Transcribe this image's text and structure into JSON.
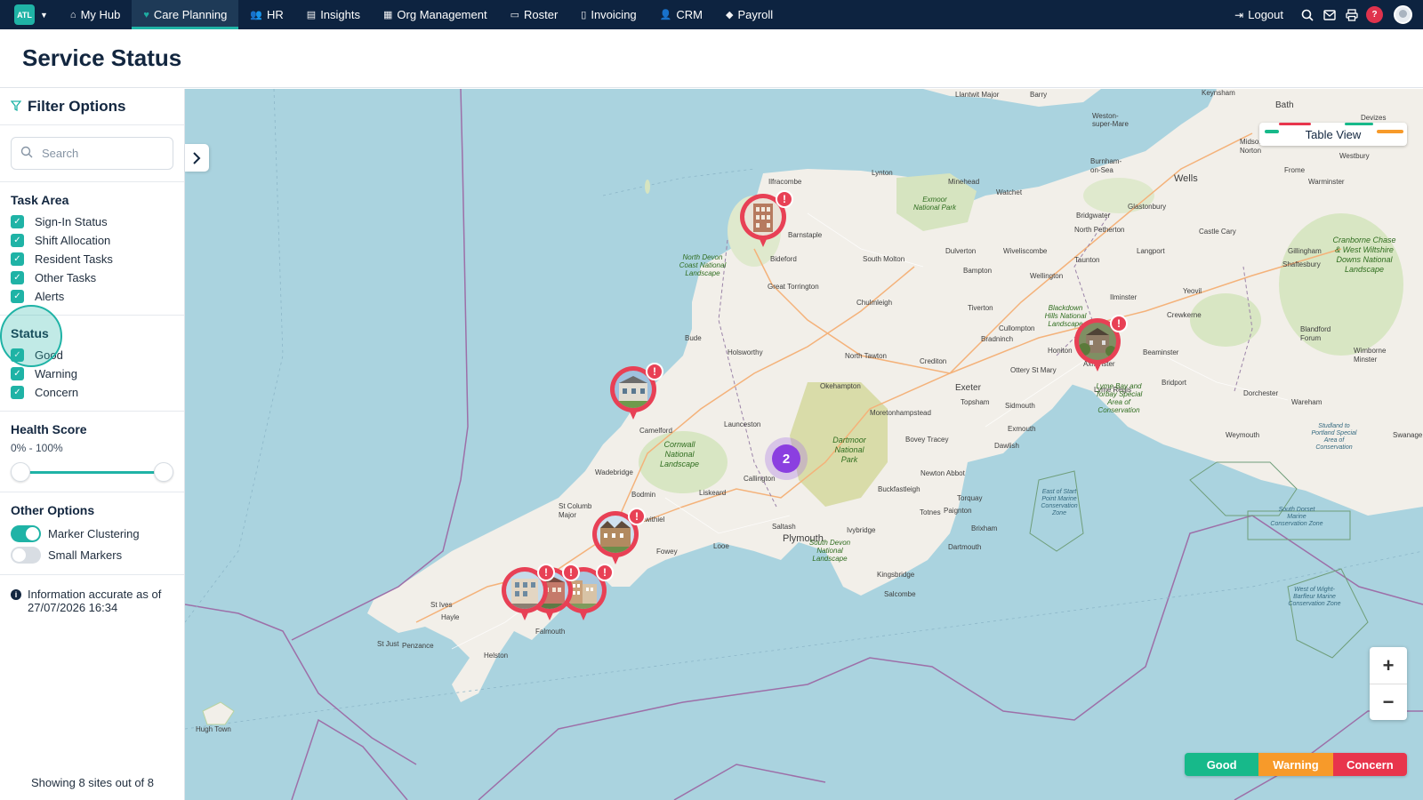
{
  "nav": {
    "brand": "ATL",
    "items": [
      {
        "label": "My Hub",
        "icon": "⌂"
      },
      {
        "label": "Care Planning",
        "icon": "♥"
      },
      {
        "label": "HR",
        "icon": "👥"
      },
      {
        "label": "Insights",
        "icon": "▤"
      },
      {
        "label": "Org Management",
        "icon": "▦"
      },
      {
        "label": "Roster",
        "icon": "▭"
      },
      {
        "label": "Invoicing",
        "icon": "▯"
      },
      {
        "label": "CRM",
        "icon": "👤"
      },
      {
        "label": "Payroll",
        "icon": "◆"
      }
    ],
    "logout": "Logout",
    "help": "?"
  },
  "page": {
    "title": "Service Status"
  },
  "sidebar": {
    "title": "Filter Options",
    "search_placeholder": "Search",
    "task_area": {
      "title": "Task Area",
      "items": [
        "Sign-In Status",
        "Shift Allocation",
        "Resident Tasks",
        "Other Tasks",
        "Alerts"
      ]
    },
    "status": {
      "title": "Status",
      "items": [
        "Good",
        "Warning",
        "Concern"
      ]
    },
    "health": {
      "title": "Health Score",
      "range": "0% - 100%",
      "min": 0,
      "max": 100
    },
    "other": {
      "title": "Other Options",
      "marker_clustering": "Marker Clustering",
      "marker_clustering_on": true,
      "small_markers": "Small Markers",
      "small_markers_on": false
    },
    "info": "Information accurate as of 27/07/2026 16:34",
    "showing": "Showing 8 sites out of 8"
  },
  "map": {
    "table_view": "Table View",
    "cluster_count": "2",
    "zoom_in": "+",
    "zoom_out": "−",
    "alert_glyph": "!",
    "legend": {
      "good": "Good",
      "warning": "Warning",
      "concern": "Concern"
    },
    "colors": {
      "good": "#17b98a",
      "warning": "#f79a2a",
      "concern": "#e8354c",
      "accent": "#1fb3a6"
    },
    "places": [
      "Llantwit Major",
      "Barry",
      "Keynsham",
      "Weston-super-Mare",
      "Bath",
      "Devizes",
      "Midsomer Norton",
      "Frome",
      "Westbury",
      "Burnham-on-Sea",
      "Wells",
      "Warminster",
      "Ilfracombe",
      "Lynton",
      "Minehead",
      "Watchet",
      "Bridgwater",
      "Glastonbury",
      "Castle Cary",
      "Barnstaple",
      "North Petherton",
      "Langport",
      "Gillingham",
      "Shaftesbury",
      "Bideford",
      "South Molton",
      "Dulverton",
      "Wiveliscombe",
      "Taunton",
      "Bampton",
      "Wellington",
      "Yeovil",
      "Great Torrington",
      "Chulmleigh",
      "Ilminster",
      "Crewkerne",
      "Tiverton",
      "Cullompton",
      "Bradninch",
      "Honiton",
      "Ottery St Mary",
      "Axminster",
      "Blandford Forum",
      "Wimborne Minster",
      "Bude",
      "Holsworthy",
      "North Tawton",
      "Crediton",
      "Beaminster",
      "Bridport",
      "Lyme Regis",
      "Dorchester",
      "Okehampton",
      "Exeter",
      "Sidmouth",
      "Topsham",
      "Wareham",
      "Camelford",
      "Launceston",
      "Moretonhampstead",
      "Bovey Tracey",
      "Dawlish",
      "Exmouth",
      "Weymouth",
      "Swanage",
      "Wadebridge",
      "Callington",
      "Newton Abbot",
      "Bodmin",
      "Liskeard",
      "Buckfastleigh",
      "Torquay",
      "St Columb Major",
      "Lostwithiel",
      "Saltash",
      "Totnes",
      "Paignton",
      "Looe",
      "Plymouth",
      "Ivybridge",
      "Brixham",
      "Fowey",
      "Dartmouth",
      "Kingsbridge",
      "Salcombe",
      "St Ives",
      "Hayle",
      "Falmouth",
      "Penzance",
      "St Just",
      "Helston",
      "Hugh Town"
    ],
    "parks": [
      "Exmoor National Park",
      "North Devon Coast National Landscape",
      "Blackdown Hills National Landscape",
      "Lyme Bay and Torbay Special Area of Conservation",
      "Dartmoor National Park",
      "Cornwall National Landscape",
      "South Devon National Landscape",
      "Cranborne Chase & West Wiltshire Downs National Landscape",
      "Studland to Portland Special Area of Conservation",
      "South Dorset Marine Conservation Zone",
      "East of Start Point Marine Conservation Zone",
      "West of Wight-Barfleur Marine Conservation Zone"
    ]
  }
}
